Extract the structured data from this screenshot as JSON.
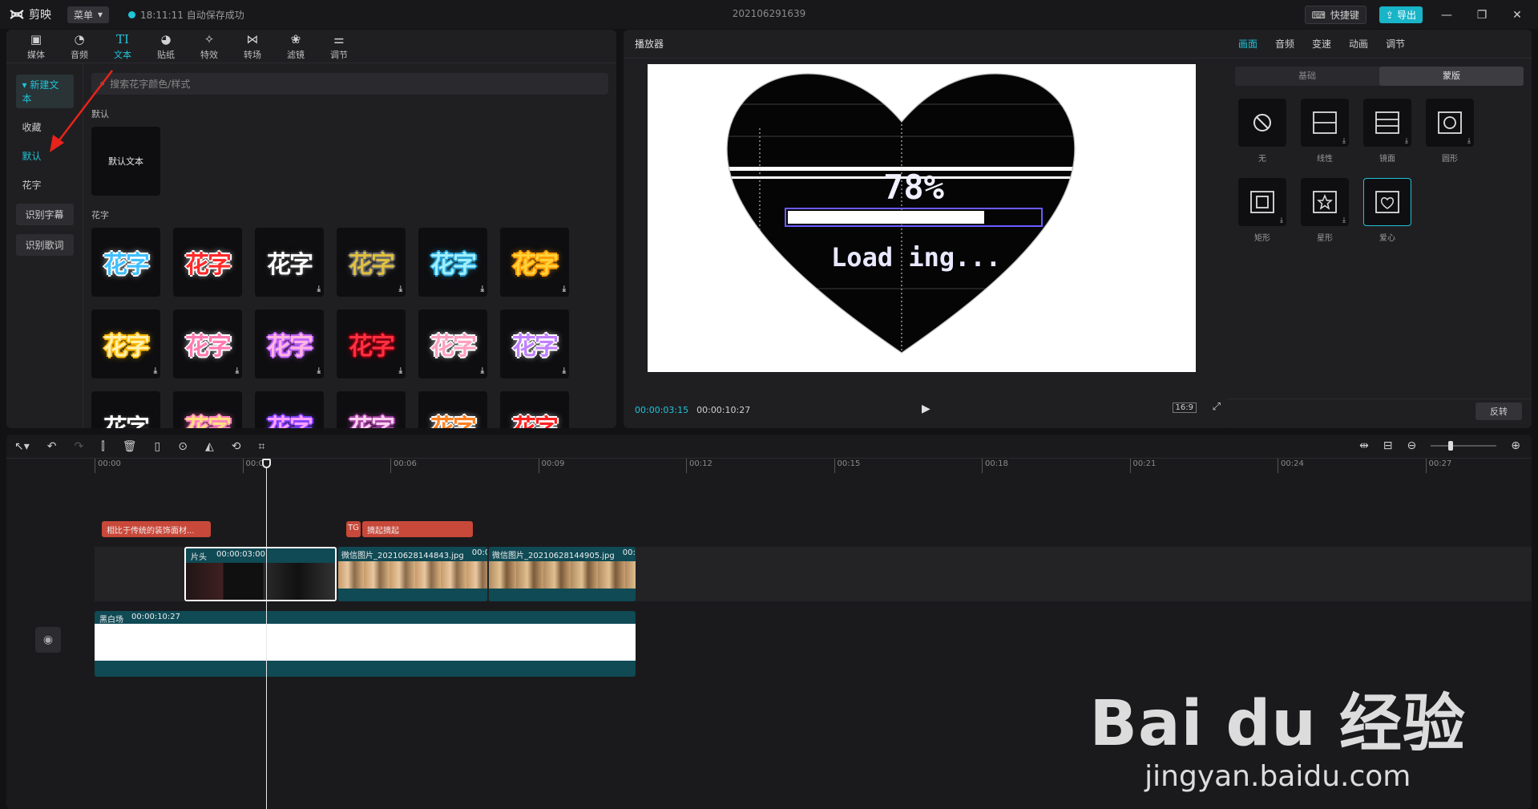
{
  "app": {
    "name": "剪映",
    "menu_label": "菜单",
    "autosave": "18:11:11 自动保存成功",
    "project_title": "202106291639",
    "shortcut_label": "快捷键",
    "export_label": "导出"
  },
  "media_tabs": [
    {
      "label": "媒体",
      "icon": "media-icon"
    },
    {
      "label": "音频",
      "icon": "audio-icon"
    },
    {
      "label": "文本",
      "icon": "text-icon",
      "active": true
    },
    {
      "label": "贴纸",
      "icon": "sticker-icon"
    },
    {
      "label": "特效",
      "icon": "effect-icon"
    },
    {
      "label": "转场",
      "icon": "transition-icon"
    },
    {
      "label": "滤镜",
      "icon": "filter-icon"
    },
    {
      "label": "调节",
      "icon": "adjust-icon"
    }
  ],
  "left_nav": {
    "new_text": "新建文本",
    "favorites": "收藏",
    "default": "默认",
    "fancy": "花字",
    "recognize_subtitle": "识别字幕",
    "recognize_lyrics": "识别歌词"
  },
  "search": {
    "placeholder": "搜索花字颜色/样式"
  },
  "sections": {
    "default_label": "默认",
    "default_tile": "默认文本",
    "fancy_label": "花字"
  },
  "fancy_tiles": [
    {
      "text": "花字",
      "color": "#3fc0ff",
      "stroke": "#ffffff"
    },
    {
      "text": "花字",
      "color": "#ff2a2a",
      "stroke": "#ffffff"
    },
    {
      "text": "花字",
      "color": "#ffffff",
      "stroke": "#333333"
    },
    {
      "text": "花字",
      "color": "#e0c040",
      "stroke": "#666666"
    },
    {
      "text": "花字",
      "color": "#9ff0ff",
      "stroke": "#2aa0d0"
    },
    {
      "text": "花字",
      "color": "#ffd23a",
      "stroke": "#ff9a00"
    },
    {
      "text": "花字",
      "color": "#fff1b0",
      "stroke": "#ffb800"
    },
    {
      "text": "花字",
      "color": "#ff7ab0",
      "stroke": "#ffffff"
    },
    {
      "text": "花字",
      "color": "#ffb6e0",
      "stroke": "#c060ff"
    },
    {
      "text": "花字",
      "color": "#ff3040",
      "stroke": "#800010"
    },
    {
      "text": "花字",
      "color": "#ffa0c0",
      "stroke": "#ffffff"
    },
    {
      "text": "花字",
      "color": "#c080ff",
      "stroke": "#ffffff"
    },
    {
      "text": "花字",
      "color": "#ffffff",
      "stroke": "#222222"
    },
    {
      "text": "花字",
      "color": "#ffe080",
      "stroke": "#ff80c0"
    },
    {
      "text": "花字",
      "color": "#ffa0ff",
      "stroke": "#8040ff"
    },
    {
      "text": "花字",
      "color": "#ffd0f0",
      "stroke": "#a040a0"
    },
    {
      "text": "花字",
      "color": "#ff8020",
      "stroke": "#ffffff"
    },
    {
      "text": "花字",
      "color": "#ff2020",
      "stroke": "#ffffff"
    }
  ],
  "player": {
    "title": "播放器",
    "current_time": "00:00:03:15",
    "total_time": "00:00:10:27",
    "ratio": "16:9",
    "canvas_text_percent": "78%",
    "canvas_text_loading": "Load ing...",
    "loading_progress": 0.78
  },
  "props": {
    "tabs": [
      "画面",
      "音频",
      "变速",
      "动画",
      "调节"
    ],
    "active_tab": "画面",
    "seg_basic": "基础",
    "seg_mask": "蒙版",
    "masks": [
      {
        "label": "无",
        "icon": "none-icon"
      },
      {
        "label": "线性",
        "icon": "linear-mask-icon",
        "download": true
      },
      {
        "label": "镜面",
        "icon": "mirror-mask-icon",
        "download": true
      },
      {
        "label": "圆形",
        "icon": "circle-mask-icon",
        "download": true
      },
      {
        "label": "矩形",
        "icon": "rect-mask-icon",
        "download": true
      },
      {
        "label": "星形",
        "icon": "star-mask-icon",
        "download": true
      },
      {
        "label": "爱心",
        "icon": "heart-mask-icon",
        "selected": true
      }
    ],
    "reverse_label": "反转"
  },
  "timeline": {
    "ticks": [
      "00:00",
      "00:03",
      "00:06",
      "00:09",
      "00:12",
      "00:15",
      "00:18",
      "00:21",
      "00:24",
      "00:27"
    ],
    "text_clip_1": "相比于传统的装饰面材...",
    "text_clip_2_tag": "TG",
    "text_clip_2": "摘起摘起",
    "video_clip_1_label": "片头",
    "video_clip_1_duration": "00:00:03:00",
    "video_clip_2_label": "微信图片_20210628144843.jpg",
    "video_clip_2_duration": "00:0",
    "video_clip_3_label": "微信图片_20210628144905.jpg",
    "video_clip_3_duration": "00:0",
    "bg_clip_label": "黑白场",
    "bg_clip_duration": "00:00:10:27"
  },
  "watermark": {
    "main": "Bai du 经验",
    "sub": "jingyan.baidu.com"
  },
  "colors": {
    "accent": "#20c4d8",
    "clip_text": "#c8483a",
    "track": "#0f4a55"
  }
}
